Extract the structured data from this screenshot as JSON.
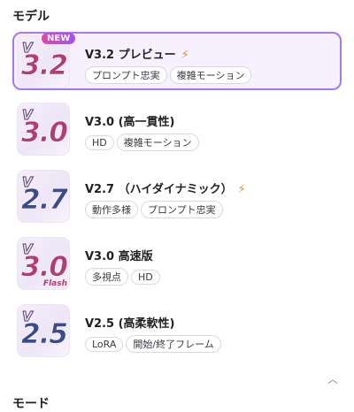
{
  "sections": {
    "models": "モデル",
    "mode": "モード"
  },
  "models": [
    {
      "version": "V",
      "number": "3.2",
      "flash": "",
      "badge": "NEW",
      "name": "V3.2 プレビュー",
      "featured": true,
      "selected": true,
      "tags": [
        "プロンプト忠実",
        "複雑モーション"
      ]
    },
    {
      "version": "V",
      "number": "3.0",
      "flash": "",
      "badge": "",
      "name": "V3.0 (高一貫性)",
      "featured": false,
      "selected": false,
      "tags": [
        "HD",
        "複雑モーション"
      ]
    },
    {
      "version": "V",
      "number": "2.7",
      "flash": "",
      "badge": "",
      "name": "V2.7 （ハイダイナミック）",
      "featured": true,
      "selected": false,
      "tags": [
        "動作多様",
        "プロンプト忠実"
      ]
    },
    {
      "version": "V",
      "number": "3.0",
      "flash": "Flash",
      "badge": "",
      "name": "V3.0 高速版",
      "featured": false,
      "selected": false,
      "tags": [
        "多視点",
        "HD"
      ]
    },
    {
      "version": "V",
      "number": "2.5",
      "flash": "",
      "badge": "",
      "name": "V2.5 (高柔軟性)",
      "featured": false,
      "selected": false,
      "tags": [
        "LoRA",
        "開始/終了フレーム"
      ]
    }
  ],
  "icons": {
    "featured": "lightning-icon",
    "collapse": "chevron-up-icon"
  },
  "colors": {
    "accent": "#a776f0",
    "selected_bg": "#f7f0ff",
    "lightning": "#f08a1a",
    "number": "#b03d76"
  }
}
